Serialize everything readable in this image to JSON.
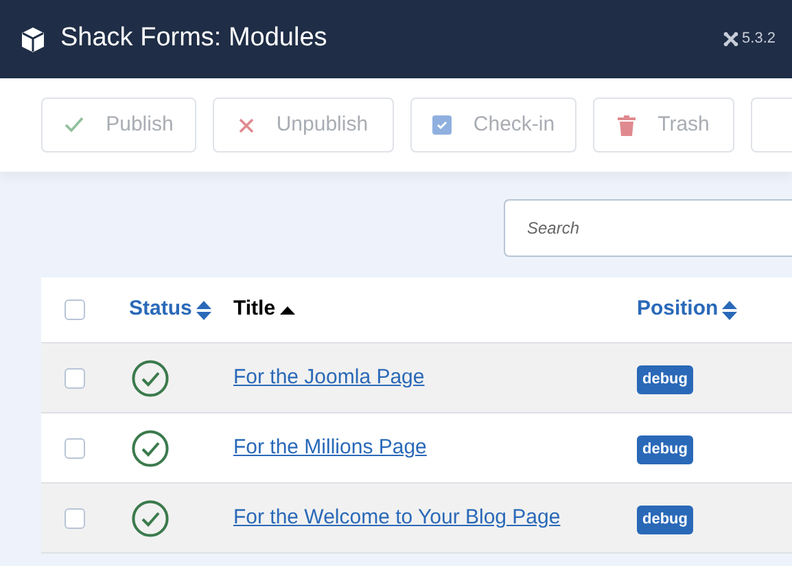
{
  "header": {
    "title": "Shack Forms: Modules",
    "version": "5.3.2"
  },
  "toolbar": [
    {
      "kind": "publish",
      "label": "Publish",
      "disabled": true
    },
    {
      "kind": "unpublish",
      "label": "Unpublish",
      "disabled": true
    },
    {
      "kind": "checkin",
      "label": "Check-in",
      "disabled": true
    },
    {
      "kind": "trash",
      "label": "Trash",
      "disabled": true
    }
  ],
  "search": {
    "placeholder": "Search"
  },
  "table": {
    "select_all": {
      "checked": false
    },
    "columns": [
      {
        "label": "Status",
        "sorted": false
      },
      {
        "label": "Title",
        "sorted": true
      },
      {
        "label": "Position",
        "sorted": false
      }
    ],
    "rows": [
      {
        "checked": false,
        "published": true,
        "title": "For the Joomla Page",
        "position": "debug"
      },
      {
        "checked": false,
        "published": true,
        "title": "For the Millions Page",
        "position": "debug"
      },
      {
        "checked": false,
        "published": true,
        "title": "For the Welcome to Your Blog Page",
        "position": "debug"
      }
    ]
  }
}
